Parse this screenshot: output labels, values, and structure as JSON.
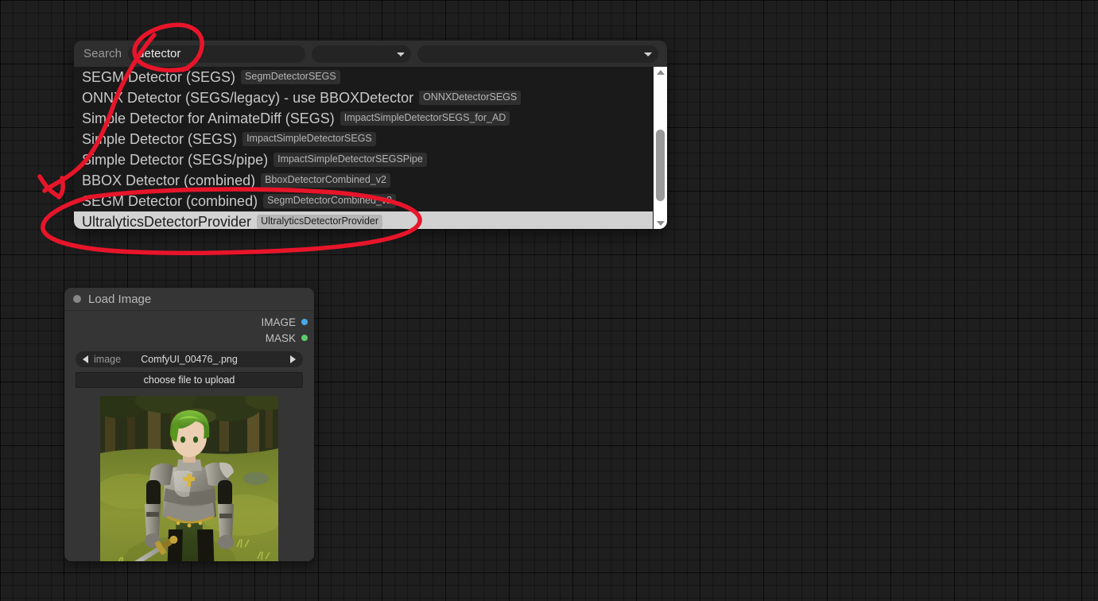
{
  "app": {
    "background_color": "#1e1e1e",
    "annotation_color": "#e8152a"
  },
  "search_dialog": {
    "search_label": "Search",
    "search_input_value": "detector",
    "search_input_placeholder": "",
    "filter_type_value": "",
    "filter_category_value": "",
    "results": [
      {
        "label": "SEGM Detector (SEGS)",
        "badge": "SegmDetectorSEGS",
        "selected": false
      },
      {
        "label": "ONNX Detector (SEGS/legacy) - use BBOXDetector",
        "badge": "ONNXDetectorSEGS",
        "selected": false
      },
      {
        "label": "Simple Detector for AnimateDiff (SEGS)",
        "badge": "ImpactSimpleDetectorSEGS_for_AD",
        "selected": false
      },
      {
        "label": "Simple Detector (SEGS)",
        "badge": "ImpactSimpleDetectorSEGS",
        "selected": false
      },
      {
        "label": "Simple Detector (SEGS/pipe)",
        "badge": "ImpactSimpleDetectorSEGSPipe",
        "selected": false
      },
      {
        "label": "BBOX Detector (combined)",
        "badge": "BboxDetectorCombined_v2",
        "selected": false
      },
      {
        "label": "SEGM Detector (combined)",
        "badge": "SegmDetectorCombined_v2",
        "selected": false
      },
      {
        "label": "UltralyticsDetectorProvider",
        "badge": "UltralyticsDetectorProvider",
        "selected": true
      }
    ],
    "scrollbar": {
      "up_arrow_icon": "triangle-up-icon",
      "down_arrow_icon": "triangle-down-icon"
    }
  },
  "node": {
    "title": "Load Image",
    "collapse_icon": "collapse-dot-icon",
    "outputs": [
      {
        "name": "IMAGE",
        "color": "#4aa8e8"
      },
      {
        "name": "MASK",
        "color": "#5ecb6b"
      }
    ],
    "widget_image": {
      "name": "image",
      "value": "ComfyUI_00476_.png",
      "prev_icon": "arrow-left-icon",
      "next_icon": "arrow-right-icon"
    },
    "upload_button_label": "choose file to upload",
    "preview_alt": "anime knight with green hair in silver armor holding a sword in a sunlit forest clearing"
  }
}
